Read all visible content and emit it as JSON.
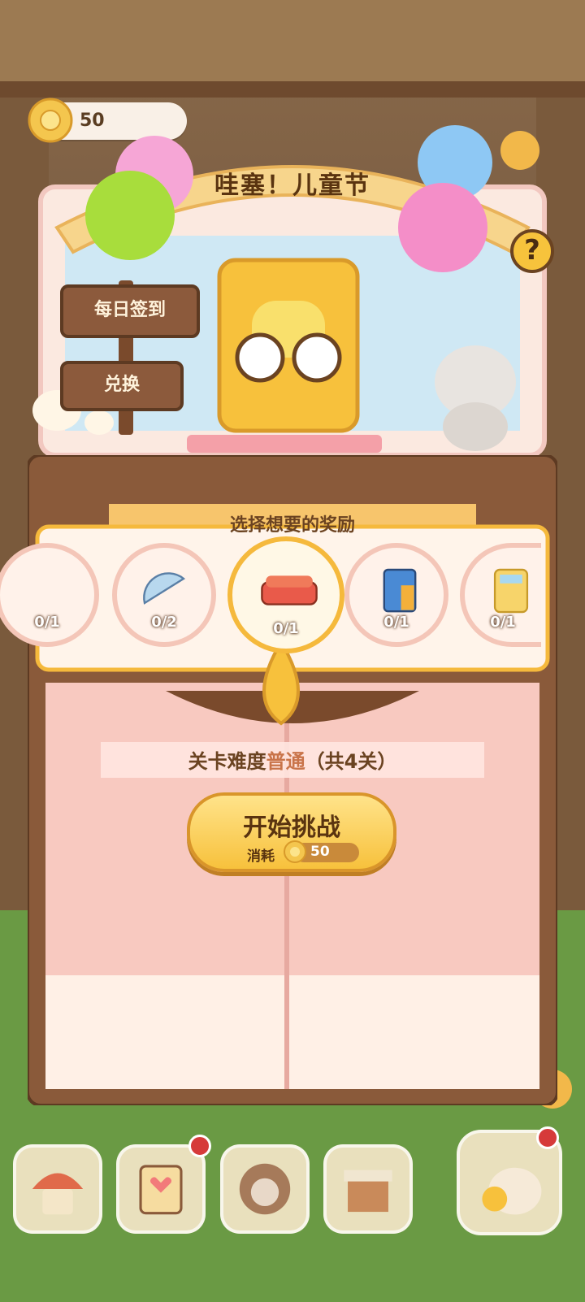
{
  "currency": {
    "amount": "50",
    "icon": "gear-coin-icon"
  },
  "event": {
    "title": "哇塞！儿童节"
  },
  "help": {
    "label": "?"
  },
  "signs": {
    "daily_checkin": "每日签到",
    "exchange": "兑换"
  },
  "rewards": {
    "header": "选择想要的奖励",
    "items": [
      {
        "icon": "pen-icon",
        "count": "0/1"
      },
      {
        "icon": "protractor-icon",
        "count": "0/2"
      },
      {
        "icon": "sofa-icon",
        "count": "0/1",
        "selected": true
      },
      {
        "icon": "cabinet-icon",
        "count": "0/1"
      },
      {
        "icon": "calculator-icon",
        "count": "0/1"
      }
    ]
  },
  "challenge": {
    "difficulty_prefix": "关卡难度",
    "difficulty_value": "普通",
    "difficulty_suffix": "（共4关）",
    "start_label": "开始挑战",
    "cost_label": "消耗",
    "cost_value": "50"
  },
  "dock": [
    {
      "icon": "mushroom-house-icon",
      "badge": false
    },
    {
      "icon": "notebook-icon",
      "badge": true
    },
    {
      "icon": "cat-portrait-icon",
      "badge": false
    },
    {
      "icon": "shop-icon",
      "badge": false
    },
    {
      "icon": "cat-fish-icon",
      "badge": true
    }
  ],
  "colors": {
    "accent": "#f7c13c",
    "wood": "#8c5a3c",
    "curtain": "#f8c9c0"
  }
}
